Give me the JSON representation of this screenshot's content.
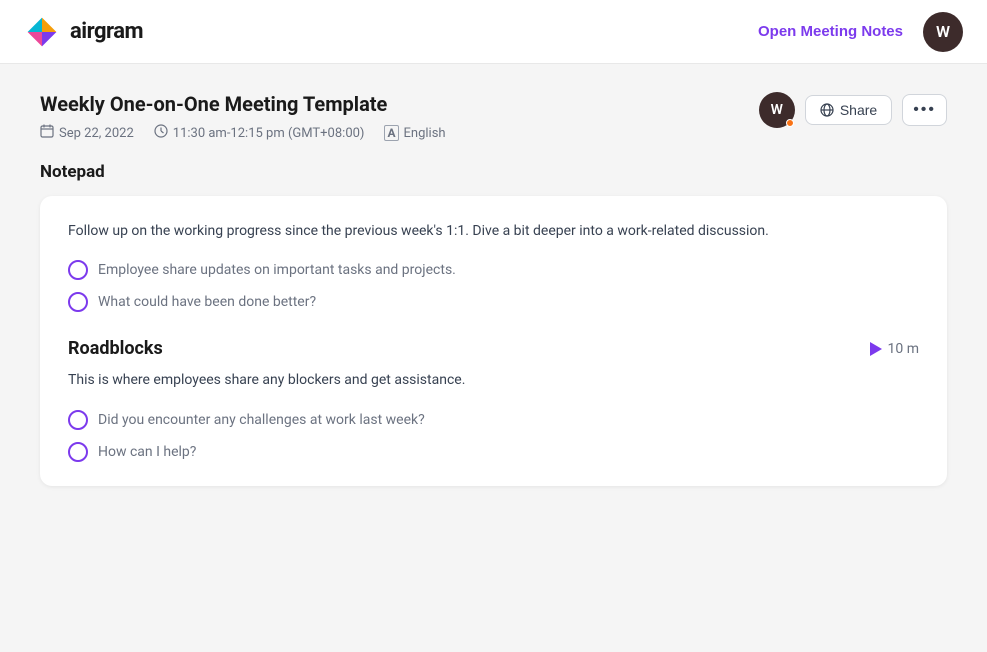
{
  "navbar": {
    "logo_text": "airgram",
    "open_meeting_btn": "Open Meeting Notes",
    "user_initial": "W"
  },
  "meeting": {
    "title": "Weekly One-on-One Meeting Template",
    "date": "Sep 22, 2022",
    "time": "11:30 am-12:15 pm (GMT+08:00)",
    "language": "English",
    "avatar_initial": "W",
    "share_label": "Share"
  },
  "notepad": {
    "section_label": "Notepad",
    "description": "Follow up on the working progress since the previous week's 1:1. Dive a bit deeper into a work-related discussion.",
    "items": [
      "Employee share updates on important tasks and projects.",
      "What could have been done better?"
    ]
  },
  "roadblocks": {
    "title": "Roadblocks",
    "timer_label": "10 m",
    "description": "This is where employees share any blockers and get assistance.",
    "items": [
      "Did you encounter any challenges at work last week?",
      "How can I help?"
    ]
  },
  "icons": {
    "calendar": "📅",
    "clock": "🕐",
    "translate": "A",
    "globe": "🌐",
    "more": "···"
  }
}
